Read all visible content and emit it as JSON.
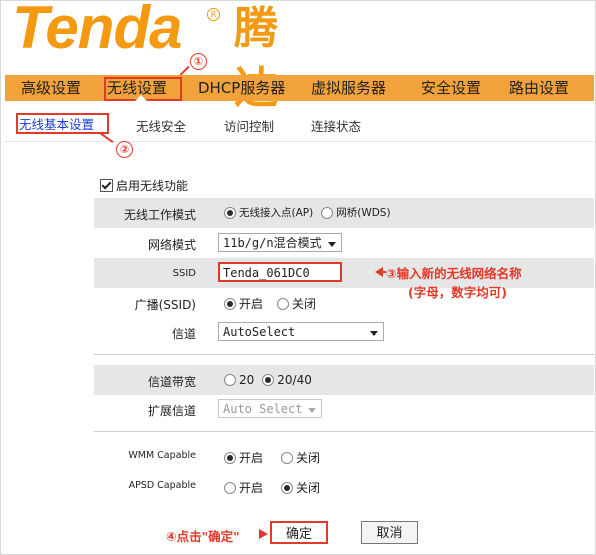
{
  "logo": {
    "text": "Tenda",
    "cn": "腾达",
    "reg": "R"
  },
  "main_nav": {
    "items": [
      "高级设置",
      "无线设置",
      "DHCP服务器",
      "虚拟服务器",
      "安全设置",
      "路由设置"
    ],
    "selected": "无线设置"
  },
  "sub_nav": {
    "items": [
      "无线基本设置",
      "无线安全",
      "访问控制",
      "连接状态"
    ],
    "selected": "无线基本设置"
  },
  "annotations": {
    "c1": "①",
    "c2": "②",
    "c3_text": "③输入新的无线网络名称",
    "c3_sub": "(字母，数字均可)",
    "c4_text": "④点击\"确定\""
  },
  "form": {
    "enable_wireless": {
      "label": "启用无线功能",
      "checked": true
    },
    "work_mode": {
      "label": "无线工作模式",
      "options": [
        "无线接入点(AP)",
        "网桥(WDS)"
      ],
      "selected": "无线接入点(AP)"
    },
    "network_mode": {
      "label": "网络模式",
      "value": "11b/g/n混合模式"
    },
    "ssid": {
      "label": "SSID",
      "value": "Tenda_061DC0"
    },
    "broadcast": {
      "label": "广播(SSID)",
      "options": [
        "开启",
        "关闭"
      ],
      "selected": "开启"
    },
    "channel": {
      "label": "信道",
      "value": "AutoSelect"
    },
    "bandwidth": {
      "label": "信道带宽",
      "options": [
        "20",
        "20/40"
      ],
      "selected": "20/40"
    },
    "ext_channel": {
      "label": "扩展信道",
      "value": "Auto Select",
      "disabled": true
    },
    "wmm": {
      "label": "WMM Capable",
      "options": [
        "开启",
        "关闭"
      ],
      "selected": "开启"
    },
    "apsd": {
      "label": "APSD Capable",
      "options": [
        "开启",
        "关闭"
      ],
      "selected": "关闭"
    }
  },
  "buttons": {
    "ok": "确定",
    "cancel": "取消"
  },
  "colors": {
    "nav_bg": "#f2a23a",
    "logo": "#f39a12",
    "annotation": "#e23a2a",
    "row_gray": "#e6e6e6",
    "link_blue": "#1a3fd0"
  }
}
